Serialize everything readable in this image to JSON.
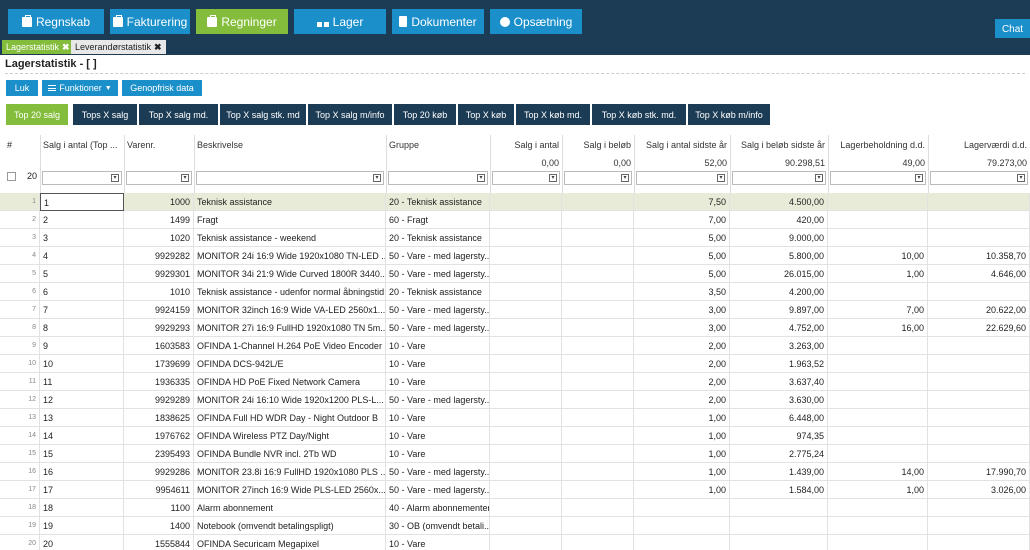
{
  "nav": [
    {
      "label": "Regnskab",
      "icon": "briefcase-icon",
      "active": false
    },
    {
      "label": "Fakturering",
      "icon": "briefcase-icon",
      "active": false
    },
    {
      "label": "Regninger",
      "icon": "briefcase-icon",
      "active": true
    },
    {
      "label": "Lager",
      "icon": "cubes-icon",
      "active": false
    },
    {
      "label": "Dokumenter",
      "icon": "document-icon",
      "active": false
    },
    {
      "label": "Opsætning",
      "icon": "gear-icon",
      "active": false
    }
  ],
  "chat_label": "Chat",
  "doc_tabs": [
    {
      "label": "Lagerstatistik",
      "close": "✖"
    },
    {
      "label": "Leverandørstatistik",
      "close": "✖"
    }
  ],
  "page_title": "Lagerstatistik - [ ]",
  "toolbar": {
    "close_label": "Luk",
    "functions_label": "Funktioner",
    "refresh_label": "Genopfrisk data"
  },
  "report_tabs": [
    "Top 20 salg",
    "Tops X salg",
    "Top X salg md.",
    "Top X salg stk. md",
    "Top X salg m/info",
    "Top 20 køb",
    "Top X køb",
    "Top X køb md.",
    "Top X køb stk. md.",
    "Top X køb m/info"
  ],
  "grid": {
    "hash": "#",
    "page_size": "20",
    "headers": [
      "Salg i antal (Top ...",
      "Varenr.",
      "Beskrivelse",
      "Gruppe",
      "Salg i antal",
      "Salg i beløb",
      "Salg i antal sidste år",
      "Salg i beløb sidste år",
      "Lagerbeholdning d.d.",
      "Lagerværdi d.d."
    ],
    "totals": [
      "0,00",
      "0,00",
      "52,00",
      "90.298,51",
      "49,00",
      "79.273,00"
    ],
    "rows": [
      [
        "1",
        "1",
        "1000",
        "Teknisk assistance",
        "20 - Teknisk assistance",
        "",
        "",
        "7,50",
        "4.500,00",
        "",
        ""
      ],
      [
        "2",
        "2",
        "1499",
        "Fragt",
        "60 - Fragt",
        "",
        "",
        "7,00",
        "420,00",
        "",
        ""
      ],
      [
        "3",
        "3",
        "1020",
        "Teknisk assistance - weekend",
        "20 - Teknisk assistance",
        "",
        "",
        "5,00",
        "9.000,00",
        "",
        ""
      ],
      [
        "4",
        "4",
        "9929282",
        "MONITOR 24i 16:9 Wide 1920x1080 TN-LED ...",
        "50 - Vare - med lagersty...",
        "",
        "",
        "5,00",
        "5.800,00",
        "10,00",
        "10.358,70"
      ],
      [
        "5",
        "5",
        "9929301",
        "MONITOR 34i 21:9 Wide Curved 1800R 3440...",
        "50 - Vare - med lagersty...",
        "",
        "",
        "5,00",
        "26.015,00",
        "1,00",
        "4.646,00"
      ],
      [
        "6",
        "6",
        "1010",
        "Teknisk assistance - udenfor normal åbningstid",
        "20 - Teknisk assistance",
        "",
        "",
        "3,50",
        "4.200,00",
        "",
        ""
      ],
      [
        "7",
        "7",
        "9924159",
        "MONITOR 32inch 16:9 Wide VA-LED 2560x1...",
        "50 - Vare - med lagersty...",
        "",
        "",
        "3,00",
        "9.897,00",
        "7,00",
        "20.622,00"
      ],
      [
        "8",
        "8",
        "9929293",
        "MONITOR 27i 16:9 FullHD 1920x1080 TN 5m...",
        "50 - Vare - med lagersty...",
        "",
        "",
        "3,00",
        "4.752,00",
        "16,00",
        "22.629,60"
      ],
      [
        "9",
        "9",
        "1603583",
        "OFINDA 1-Channel H.264 PoE Video Encoder",
        "10 - Vare",
        "",
        "",
        "2,00",
        "3.263,00",
        "",
        ""
      ],
      [
        "10",
        "10",
        "1739699",
        "OFINDA DCS-942L/E",
        "10 - Vare",
        "",
        "",
        "2,00",
        "1.963,52",
        "",
        ""
      ],
      [
        "11",
        "11",
        "1936335",
        "OFINDA HD PoE Fixed Network Camera",
        "10 - Vare",
        "",
        "",
        "2,00",
        "3.637,40",
        "",
        ""
      ],
      [
        "12",
        "12",
        "9929289",
        "MONITOR 24i 16:10 Wide 1920x1200 PLS-L...",
        "50 - Vare - med lagersty...",
        "",
        "",
        "2,00",
        "3.630,00",
        "",
        ""
      ],
      [
        "13",
        "13",
        "1838625",
        "OFINDA Full HD WDR Day - Night Outdoor B",
        "10 - Vare",
        "",
        "",
        "1,00",
        "6.448,00",
        "",
        ""
      ],
      [
        "14",
        "14",
        "1976762",
        "OFINDA Wireless PTZ Day/Night",
        "10 - Vare",
        "",
        "",
        "1,00",
        "974,35",
        "",
        ""
      ],
      [
        "15",
        "15",
        "2395493",
        "OFINDA Bundle NVR incl. 2Tb WD",
        "10 - Vare",
        "",
        "",
        "1,00",
        "2.775,24",
        "",
        ""
      ],
      [
        "16",
        "16",
        "9929286",
        "MONITOR 23.8i 16:9 FullHD 1920x1080 PLS ...",
        "50 - Vare - med lagersty...",
        "",
        "",
        "1,00",
        "1.439,00",
        "14,00",
        "17.990,70"
      ],
      [
        "17",
        "17",
        "9954611",
        "MONITOR 27inch 16:9 Wide PLS-LED 2560x...",
        "50 - Vare - med lagersty...",
        "",
        "",
        "1,00",
        "1.584,00",
        "1,00",
        "3.026,00"
      ],
      [
        "18",
        "18",
        "1100",
        "Alarm abonnement",
        "40 - Alarm abonnementer",
        "",
        "",
        "",
        "",
        "",
        ""
      ],
      [
        "19",
        "19",
        "1400",
        "Notebook (omvendt betalingspligt)",
        "30 - OB (omvendt betali...",
        "",
        "",
        "",
        "",
        "",
        ""
      ],
      [
        "20",
        "20",
        "1555844",
        "OFINDA Securicam Megapixel",
        "10 - Vare",
        "",
        "",
        "",
        "",
        "",
        ""
      ]
    ]
  }
}
